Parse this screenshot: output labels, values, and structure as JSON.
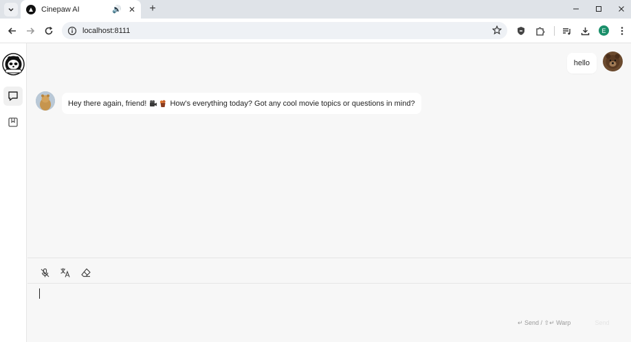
{
  "browser": {
    "tab_title": "Cinepaw AI",
    "url": "localhost:8111",
    "profile_initial": "E",
    "new_tab_glyph": "+",
    "close_glyph": "✕",
    "audio_glyph": "🔊"
  },
  "window_controls": {
    "minimize": "—",
    "maximize": "☐",
    "close": "✕"
  },
  "sidebar": {
    "items": [
      {
        "name": "chat-icon",
        "active": true
      },
      {
        "name": "bookmark-icon",
        "active": false
      }
    ]
  },
  "chat": {
    "messages": [
      {
        "role": "user",
        "text": "hello"
      },
      {
        "role": "assistant",
        "text_before": "Hey there again, friend!",
        "text_after": "How's everything today? Got any cool movie topics or questions in mind?"
      }
    ]
  },
  "composer": {
    "tools": [
      "mic-off-icon",
      "translate-icon",
      "eraser-icon"
    ],
    "input_value": "",
    "hint": "↵ Send / ⇧↵ Warp",
    "send_label": "Send"
  },
  "colors": {
    "profile": "#1a8f6a",
    "background": "#f7f7f7"
  }
}
